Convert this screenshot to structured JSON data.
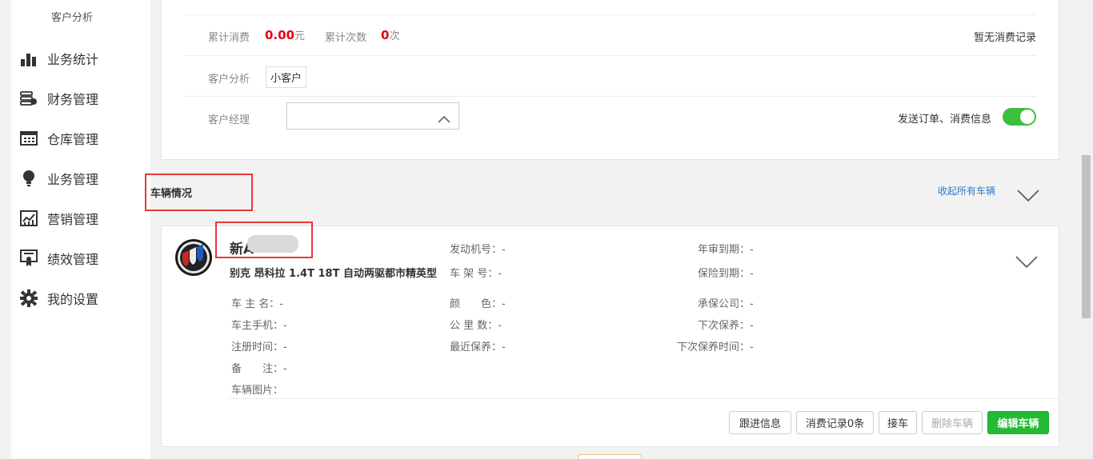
{
  "sidebar": {
    "sub_item": "客户分析",
    "items": [
      {
        "label": "业务统计",
        "icon": "bar-chart-icon"
      },
      {
        "label": "财务管理",
        "icon": "coins-icon"
      },
      {
        "label": "仓库管理",
        "icon": "warehouse-icon"
      },
      {
        "label": "业务管理",
        "icon": "lightbulb-icon"
      },
      {
        "label": "营销管理",
        "icon": "marketing-chart-icon"
      },
      {
        "label": "绩效管理",
        "icon": "certificate-icon"
      },
      {
        "label": "我的设置",
        "icon": "gear-icon"
      }
    ]
  },
  "customer": {
    "total_spend_label": "累计消费",
    "total_spend_value": "0.00",
    "total_spend_unit": "元",
    "total_count_label": "累计次数",
    "total_count_value": "0",
    "total_count_unit": "次",
    "no_records": "暂无消费记录",
    "analysis_label": "客户分析",
    "analysis_tag": "小客户",
    "manager_label": "客户经理",
    "manager_value": "",
    "notify_label": "发送订单、消费信息",
    "notify_on": true
  },
  "vehicles": {
    "section_title": "车辆情况",
    "collapse_all": "收起所有车辆"
  },
  "vehicle": {
    "plate": "新A",
    "model": "别克 昂科拉 1.4T 18T 自动两驱都市精英型",
    "fields": {
      "engine_no": "发动机号：-",
      "frame_no": "车 架 号：-",
      "inspection_due": "年审到期：-",
      "insurance_due": "保险到期：-",
      "owner": "车 主 名：-",
      "color": "颜　　色：-",
      "insurer": "承保公司：-",
      "owner_phone": "车主手机：-",
      "mileage": "公 里 数：-",
      "next_service": "下次保养：-",
      "reg_date": "注册时间：-",
      "last_service": "最近保养：-",
      "next_service_date": "下次保养时间：-",
      "remark": "备　　注：-",
      "images": "车辆图片："
    },
    "buttons": {
      "follow_up": "跟进信息",
      "records": "消费记录0条",
      "pickup": "接车",
      "delete": "删除车辆",
      "edit": "编辑车辆"
    },
    "colors": {
      "primary": "#22bb33",
      "link": "#2a7ac9",
      "amount": "#e60012"
    }
  }
}
